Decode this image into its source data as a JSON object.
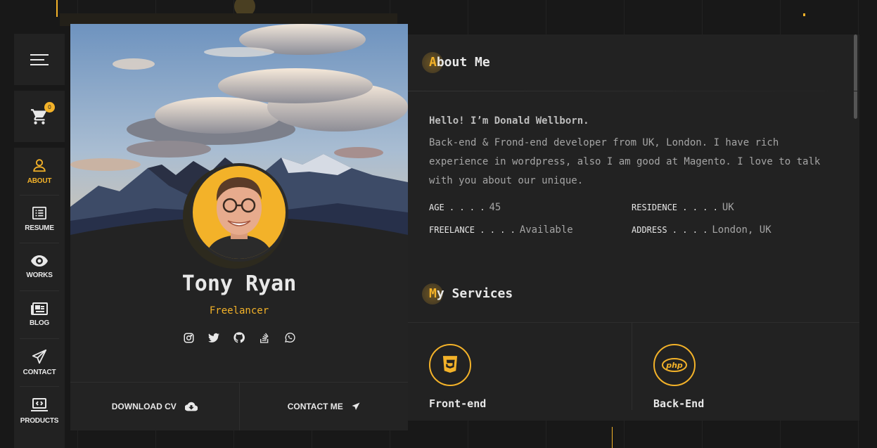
{
  "nav": {
    "cart_count": "0",
    "items": [
      {
        "label": "ABOUT",
        "icon": "user-icon"
      },
      {
        "label": "RESUME",
        "icon": "resume-icon"
      },
      {
        "label": "WORKS",
        "icon": "eye-icon"
      },
      {
        "label": "BLOG",
        "icon": "newspaper-icon"
      },
      {
        "label": "CONTACT",
        "icon": "paper-plane-icon"
      },
      {
        "label": "PRODUCTS",
        "icon": "laptop-code-icon"
      }
    ]
  },
  "profile": {
    "name": "Tony Ryan",
    "role": "Freelancer",
    "socials": [
      "instagram-icon",
      "twitter-icon",
      "github-icon",
      "stackoverflow-icon",
      "whatsapp-icon"
    ],
    "download_cv": "DOWNLOAD CV",
    "contact_me": "CONTACT ME"
  },
  "about": {
    "title_first": "A",
    "title_rest": "bout Me",
    "greeting": "Hello! I’m Donald Wellborn.",
    "bio": "Back-end & Frond-end developer from UK, London. I have rich experience in wordpress, also I am good at Magento. I love to talk with you about our unique.",
    "info": [
      {
        "label": "AGE . . . .",
        "value": "45"
      },
      {
        "label": "RESIDENCE . . . .",
        "value": "UK"
      },
      {
        "label": "FREELANCE . . . .",
        "value": "Available"
      },
      {
        "label": "ADDRESS . . . .",
        "value": "London, UK"
      }
    ]
  },
  "services": {
    "title_first": "M",
    "title_rest": "y Services",
    "items": [
      {
        "title": "Front-end",
        "icon": "html5-icon"
      },
      {
        "title": "Back-End",
        "icon": "php-icon"
      }
    ]
  },
  "colors": {
    "accent": "#f3b229",
    "bg": "#181818",
    "panel": "#222222"
  }
}
